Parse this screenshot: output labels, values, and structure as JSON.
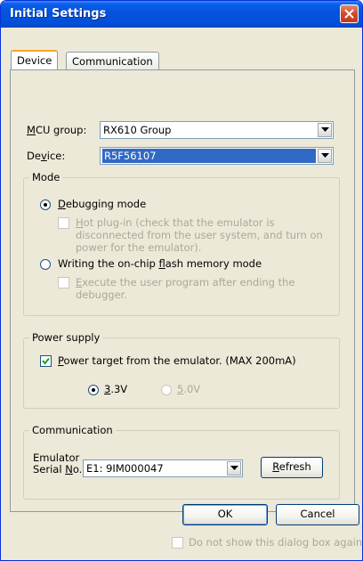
{
  "window": {
    "title": "Initial Settings"
  },
  "tabs": [
    {
      "label": "Device",
      "active": true
    },
    {
      "label": "Communication",
      "active": false
    }
  ],
  "device": {
    "mcu_group_label_pre": "",
    "mcu_group_label_u": "M",
    "mcu_group_label_post": "CU group:",
    "mcu_group_value": "RX610 Group",
    "device_label_pre": "De",
    "device_label_u": "v",
    "device_label_post": "ice:",
    "device_value": "R5F56107"
  },
  "mode": {
    "title": "Mode",
    "debugging_pre": "",
    "debugging_u": "D",
    "debugging_post": "ebugging mode",
    "hotplug_pre": "",
    "hotplug_u": "H",
    "hotplug_line1": "ot plug-in (check that the emulator is",
    "hotplug_line2": "disconnected from the user system, and turn on",
    "hotplug_line3": "power for the emulator).",
    "writing_pre": "Writing the on-chip ",
    "writing_u": "f",
    "writing_post": "lash memory mode",
    "execute_pre": "",
    "execute_u": "E",
    "execute_line1": "xecute the user program after ending the",
    "execute_line2": "debugger."
  },
  "power": {
    "title": "Power supply",
    "target_pre": "",
    "target_u": "P",
    "target_post": "ower target from the emulator. (MAX 200mA)",
    "v33_pre": "",
    "v33_u": "3",
    "v33_post": ".3V",
    "v50_pre": "",
    "v50_u": "5",
    "v50_post": ".0V"
  },
  "communication": {
    "title": "Communication",
    "serial_label_line1": "Emulator",
    "serial_label_line2_pre": "Serial ",
    "serial_label_line2_u": "N",
    "serial_label_line2_post": "o.:",
    "serial_value": "E1: 9IM000047",
    "refresh_pre": "",
    "refresh_u": "R",
    "refresh_post": "efresh"
  },
  "buttons": {
    "ok": "OK",
    "cancel": "Cancel"
  },
  "footer": {
    "dont_show": "Do not show this dialog box again."
  }
}
